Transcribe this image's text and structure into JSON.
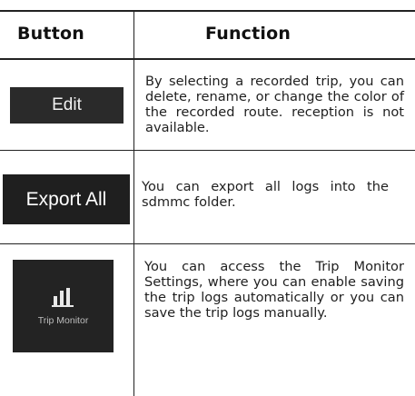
{
  "table": {
    "header": {
      "button": "Button",
      "function": "Function"
    },
    "rows": [
      {
        "button_label": "Edit",
        "description": "By selecting a recorded trip, you can delete, rename, or change the color of the recorded route. reception is not available."
      },
      {
        "button_label": "Export All",
        "description": "You can export all logs into the sdmmc folder."
      },
      {
        "button_label": "Trip Monitor",
        "button_icon": "bar-chart-icon",
        "description": "You can access the Trip Monitor Settings, where you can enable saving the trip logs automatically or you can save the trip logs manually."
      }
    ]
  },
  "colors": {
    "button_background": "#262626",
    "button_text": "#f2f2f2",
    "rule": "#222222"
  }
}
